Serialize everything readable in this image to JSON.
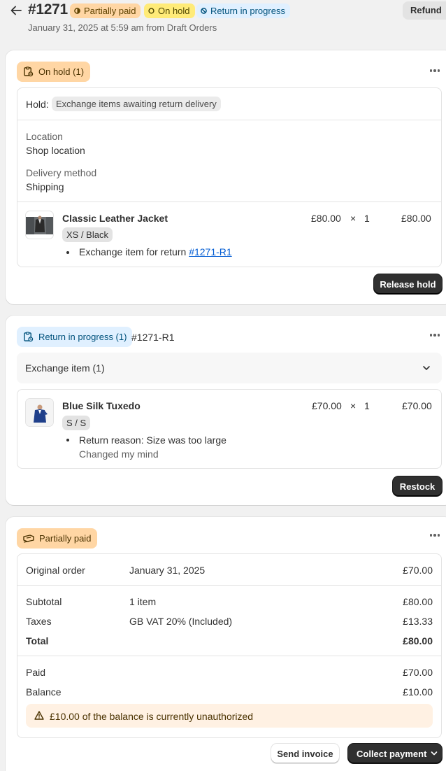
{
  "header": {
    "order_number": "#1271",
    "badges": {
      "payment": "Partially paid",
      "hold": "On hold",
      "return": "Return in progress"
    },
    "refund_label": "Refund",
    "subtitle": "January 31, 2025 at 5:59 am from Draft Orders"
  },
  "hold_card": {
    "status": "On hold (1)",
    "hold_label": "Hold:",
    "hold_reason": "Exchange items awaiting return delivery",
    "location_label": "Location",
    "location_value": "Shop location",
    "delivery_label": "Delivery method",
    "delivery_value": "Shipping",
    "item": {
      "name": "Classic Leather Jacket",
      "variant": "XS / Black",
      "note_prefix": "Exchange item for return ",
      "note_link": "#1271-R1",
      "price": "£80.00",
      "times": "×",
      "qty": "1",
      "total": "£80.00"
    },
    "release_label": "Release hold"
  },
  "return_card": {
    "status": "Return in progress (1)",
    "return_id": "#1271-R1",
    "exchange_label": "Exchange item (1)",
    "item": {
      "name": "Blue Silk Tuxedo",
      "variant": "S / S",
      "reason": "Return reason: Size was too large",
      "reason_note": "Changed my mind",
      "price": "£70.00",
      "times": "×",
      "qty": "1",
      "total": "£70.00"
    },
    "restock_label": "Restock"
  },
  "payment_card": {
    "status": "Partially paid",
    "original_order": {
      "label": "Original order",
      "detail": "January 31, 2025",
      "amount": "£70.00"
    },
    "subtotal": {
      "label": "Subtotal",
      "detail": "1 item",
      "amount": "£80.00"
    },
    "taxes": {
      "label": "Taxes",
      "detail": "GB VAT 20% (Included)",
      "amount": "£13.33"
    },
    "total": {
      "label": "Total",
      "amount": "£80.00"
    },
    "paid": {
      "label": "Paid",
      "amount": "£70.00"
    },
    "balance": {
      "label": "Balance",
      "amount": "£10.00"
    },
    "warning": "£10.00 of the balance is currently unauthorized",
    "send_invoice_label": "Send invoice",
    "collect_payment_label": "Collect payment"
  },
  "colors": {
    "badge_orange": "#ffd6a4",
    "badge_yellow": "#ffeb78",
    "badge_blue": "#e0f0ff",
    "link": "#005bd3",
    "primary_button": "#303030"
  }
}
